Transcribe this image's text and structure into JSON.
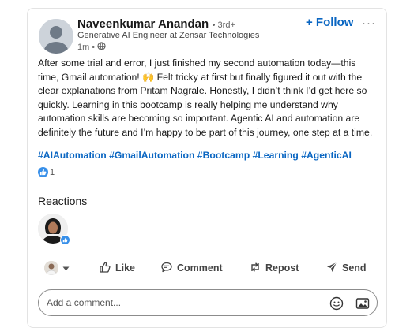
{
  "post": {
    "author": {
      "name": "Naveenkumar Anandan",
      "degree": "3rd+",
      "headline": "Generative AI Engineer at Zensar Technologies",
      "time": "1m",
      "meta_separator": "•"
    },
    "follow_label": "+ Follow",
    "more_label": "···",
    "text_part1": "After some trial and error, I just finished my second automation today—this time, Gmail automation!",
    "emoji": "🙌",
    "text_part2": "Felt tricky at first but finally figured it out with the clear explanations from Pritam Nagrale. Honestly, I didn’t think I’d get here so quickly. Learning in this bootcamp is really helping me understand why automation skills are becoming so important. Agentic AI and automation are definitely the future and I’m happy to be part of this journey, one step at a time.",
    "hashtags": [
      "#AIAutomation",
      "#GmailAutomation",
      "#Bootcamp",
      "#Learning",
      "#AgenticAI"
    ],
    "reaction_count": "1"
  },
  "reactions": {
    "title": "Reactions"
  },
  "actions": {
    "like": "Like",
    "comment": "Comment",
    "repost": "Repost",
    "send": "Send"
  },
  "comment_box": {
    "placeholder": "Add a comment..."
  },
  "colors": {
    "accent": "#0a66c2",
    "like_badge": "#378fe9"
  }
}
